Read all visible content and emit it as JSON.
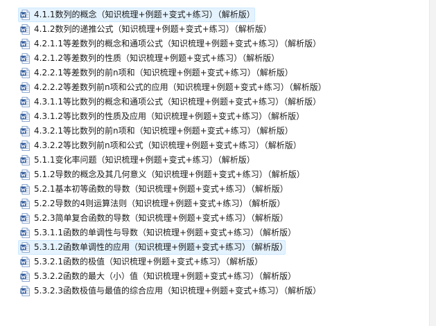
{
  "colors": {
    "selection_bg": "#e5f3ff",
    "selection_border": "#cce8ff",
    "word_icon_blue": "#2b579a"
  },
  "icon": "word-document-icon",
  "files": [
    {
      "name": "4.1.1数列的概念（知识梳理+例题+变式+练习）（解析版）",
      "selected": true
    },
    {
      "name": "4.1.2数列的递推公式（知识梳理+例题+变式+练习）（解析版）",
      "selected": false
    },
    {
      "name": "4.2.1.1等差数列的概念和通项公式（知识梳理+例题+变式+练习）（解析版）",
      "selected": false
    },
    {
      "name": "4.2.1.2等差数列的性质（知识梳理+例题+变式+练习）（解析版）",
      "selected": false
    },
    {
      "name": "4.2.2.1等差数列的前n项和（知识梳理+例题+变式+练习）（解析版）",
      "selected": false
    },
    {
      "name": "4.2.2.2等差数列前n项和公式的应用（知识梳理+例题+变式+练习）（解析版）",
      "selected": false
    },
    {
      "name": "4.3.1.1等比数列的概念和通项公式（知识梳理+例题+变式+练习）（解析版）",
      "selected": false
    },
    {
      "name": "4.3.1.2等比数列的性质及应用（知识梳理+例题+变式+练习）（解析版）",
      "selected": false
    },
    {
      "name": "4.3.2.1等比数列的前n项和（知识梳理+例题+变式+练习）（解析版）",
      "selected": false
    },
    {
      "name": "4.3.2.2等比数列前n项和公式（知识梳理+例题+变式+练习）（解析版）",
      "selected": false
    },
    {
      "name": "5.1.1变化率问题（知识梳理+例题+变式+练习）（解析版）",
      "selected": false
    },
    {
      "name": "5.1.2导数的概念及其几何意义（知识梳理+例题+变式+练习）（解析版）",
      "selected": false
    },
    {
      "name": "5.2.1基本初等函数的导数（知识梳理+例题+变式+练习）（解析版）",
      "selected": false
    },
    {
      "name": "5.2.2导数的4则运算法则（知识梳理+例题+变式+练习）（解析版）",
      "selected": false
    },
    {
      "name": "5.2.3简单复合函数的导数（知识梳理+例题+变式+练习）（解析版）",
      "selected": false
    },
    {
      "name": "5.3.1.1函数的单调性与导数（知识梳理+例题+变式+练习）（解析版）",
      "selected": false
    },
    {
      "name": "5.3.1.2函数单调性的应用（知识梳理+例题+变式+练习）（解析版）",
      "selected": true
    },
    {
      "name": "5.3.2.1函数的极值（知识梳理+例题+变式+练习）（解析版）",
      "selected": false
    },
    {
      "name": "5.3.2.2函数的最大（小）值（知识梳理+例题+变式+练习）（解析版）",
      "selected": false
    },
    {
      "name": "5.3.2.3函数极值与最值的综合应用（知识梳理+例题+变式+练习）（解析版）",
      "selected": false
    }
  ]
}
